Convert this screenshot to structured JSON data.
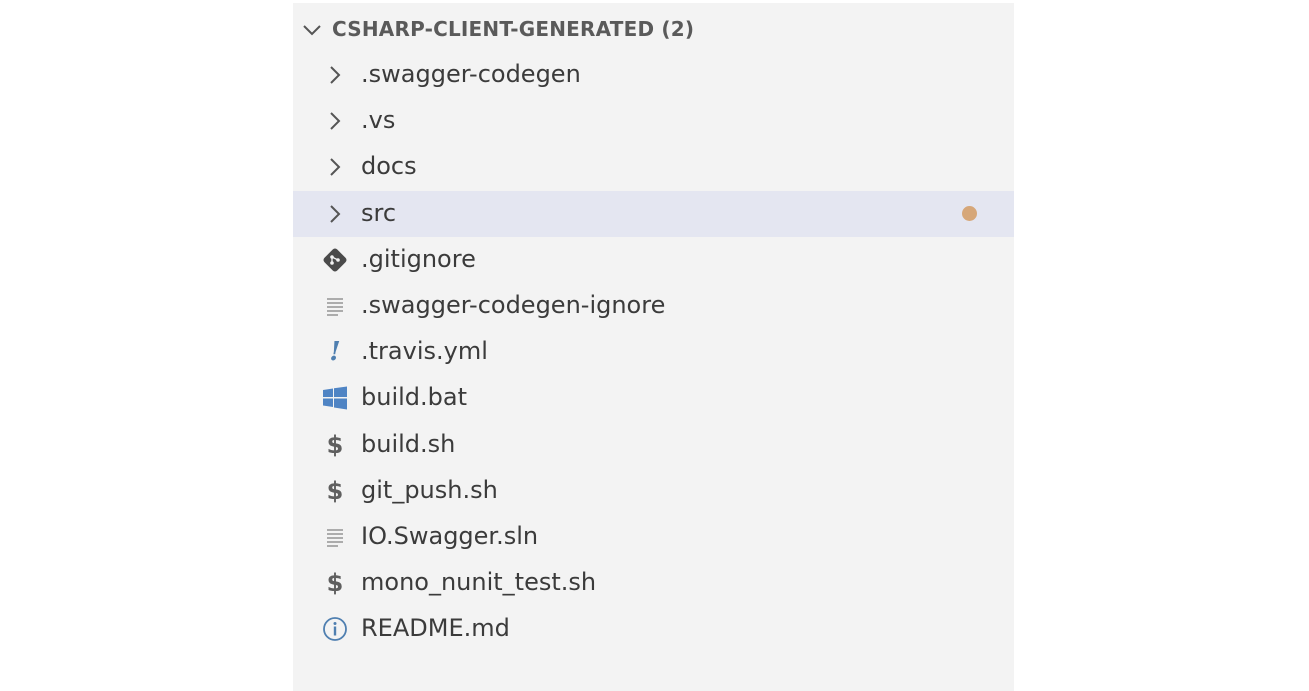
{
  "explorer": {
    "section_title": "CSHARP-CLIENT-GENERATED (2)",
    "items": [
      {
        "label": ".swagger-codegen",
        "type": "folder",
        "icon": "chevron-right-icon"
      },
      {
        "label": ".vs",
        "type": "folder",
        "icon": "chevron-right-icon"
      },
      {
        "label": "docs",
        "type": "folder",
        "icon": "chevron-right-icon"
      },
      {
        "label": "src",
        "type": "folder",
        "icon": "chevron-right-icon",
        "selected": true,
        "modified_dot_color": "#d6a779"
      },
      {
        "label": ".gitignore",
        "type": "file",
        "icon": "git-icon"
      },
      {
        "label": ".swagger-codegen-ignore",
        "type": "file",
        "icon": "text-lines-icon"
      },
      {
        "label": ".travis.yml",
        "type": "file",
        "icon": "exclamation-icon"
      },
      {
        "label": "build.bat",
        "type": "file",
        "icon": "windows-icon"
      },
      {
        "label": "build.sh",
        "type": "file",
        "icon": "dollar-icon"
      },
      {
        "label": "git_push.sh",
        "type": "file",
        "icon": "dollar-icon"
      },
      {
        "label": "IO.Swagger.sln",
        "type": "file",
        "icon": "text-lines-icon"
      },
      {
        "label": "mono_nunit_test.sh",
        "type": "file",
        "icon": "dollar-icon"
      },
      {
        "label": "README.md",
        "type": "file",
        "icon": "info-icon"
      }
    ]
  },
  "colors": {
    "panel_bg": "#f3f3f3",
    "selected_row_bg": "#e4e6f1",
    "text": "#3b3b3b",
    "header_text": "#5a5a5a",
    "windows_icon": "#4f84c4",
    "info_icon": "#4f7fb0"
  }
}
